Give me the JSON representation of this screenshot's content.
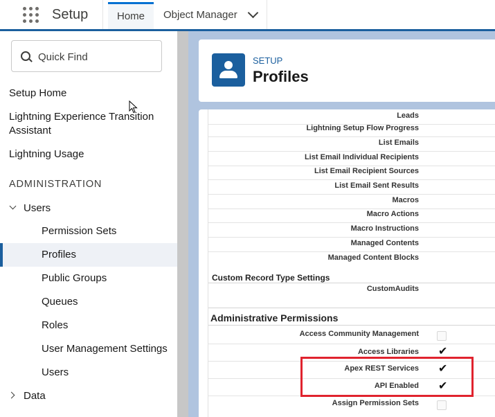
{
  "topbar": {
    "app_name": "Setup",
    "tabs": [
      {
        "label": "Home",
        "active": true
      },
      {
        "label": "Object Manager",
        "has_dropdown": true
      }
    ]
  },
  "sidebar": {
    "quick_find_placeholder": "Quick Find",
    "items": {
      "setup_home": "Setup Home",
      "lightning_transition": "Lightning Experience Transition Assistant",
      "lightning_usage": "Lightning Usage",
      "administration": "ADMINISTRATION",
      "users_group": "Users",
      "permission_sets": "Permission Sets",
      "profiles": "Profiles",
      "public_groups": "Public Groups",
      "queues": "Queues",
      "roles": "Roles",
      "user_management_settings": "User Management Settings",
      "users": "Users",
      "data": "Data"
    },
    "selected": "Profiles"
  },
  "header": {
    "breadcrumb": "SETUP",
    "title": "Profiles"
  },
  "permissions": {
    "object_rows": [
      "Leads",
      "Lightning Setup Flow Progress",
      "List Emails",
      "List Email Individual Recipients",
      "List Email Recipient Sources",
      "List Email Sent Results",
      "Macros",
      "Macro Actions",
      "Macro Instructions",
      "Managed Contents",
      "Managed Content Blocks"
    ],
    "custom_record_type_title": "Custom Record Type Settings",
    "custom_record_rows": [
      "CustomAudits"
    ],
    "admin_title": "Administrative Permissions",
    "admin_rows": [
      {
        "label": "Access Community Management",
        "checked": false
      },
      {
        "label": "Access Libraries",
        "checked": true
      },
      {
        "label": "Apex REST Services",
        "checked": true
      },
      {
        "label": "API Enabled",
        "checked": true
      },
      {
        "label": "Assign Permission Sets",
        "checked": false
      }
    ],
    "check_glyph": "✔"
  },
  "colors": {
    "accent": "#1b5f9e",
    "highlight": "#e0232e",
    "main_background": "#b0c4df"
  }
}
